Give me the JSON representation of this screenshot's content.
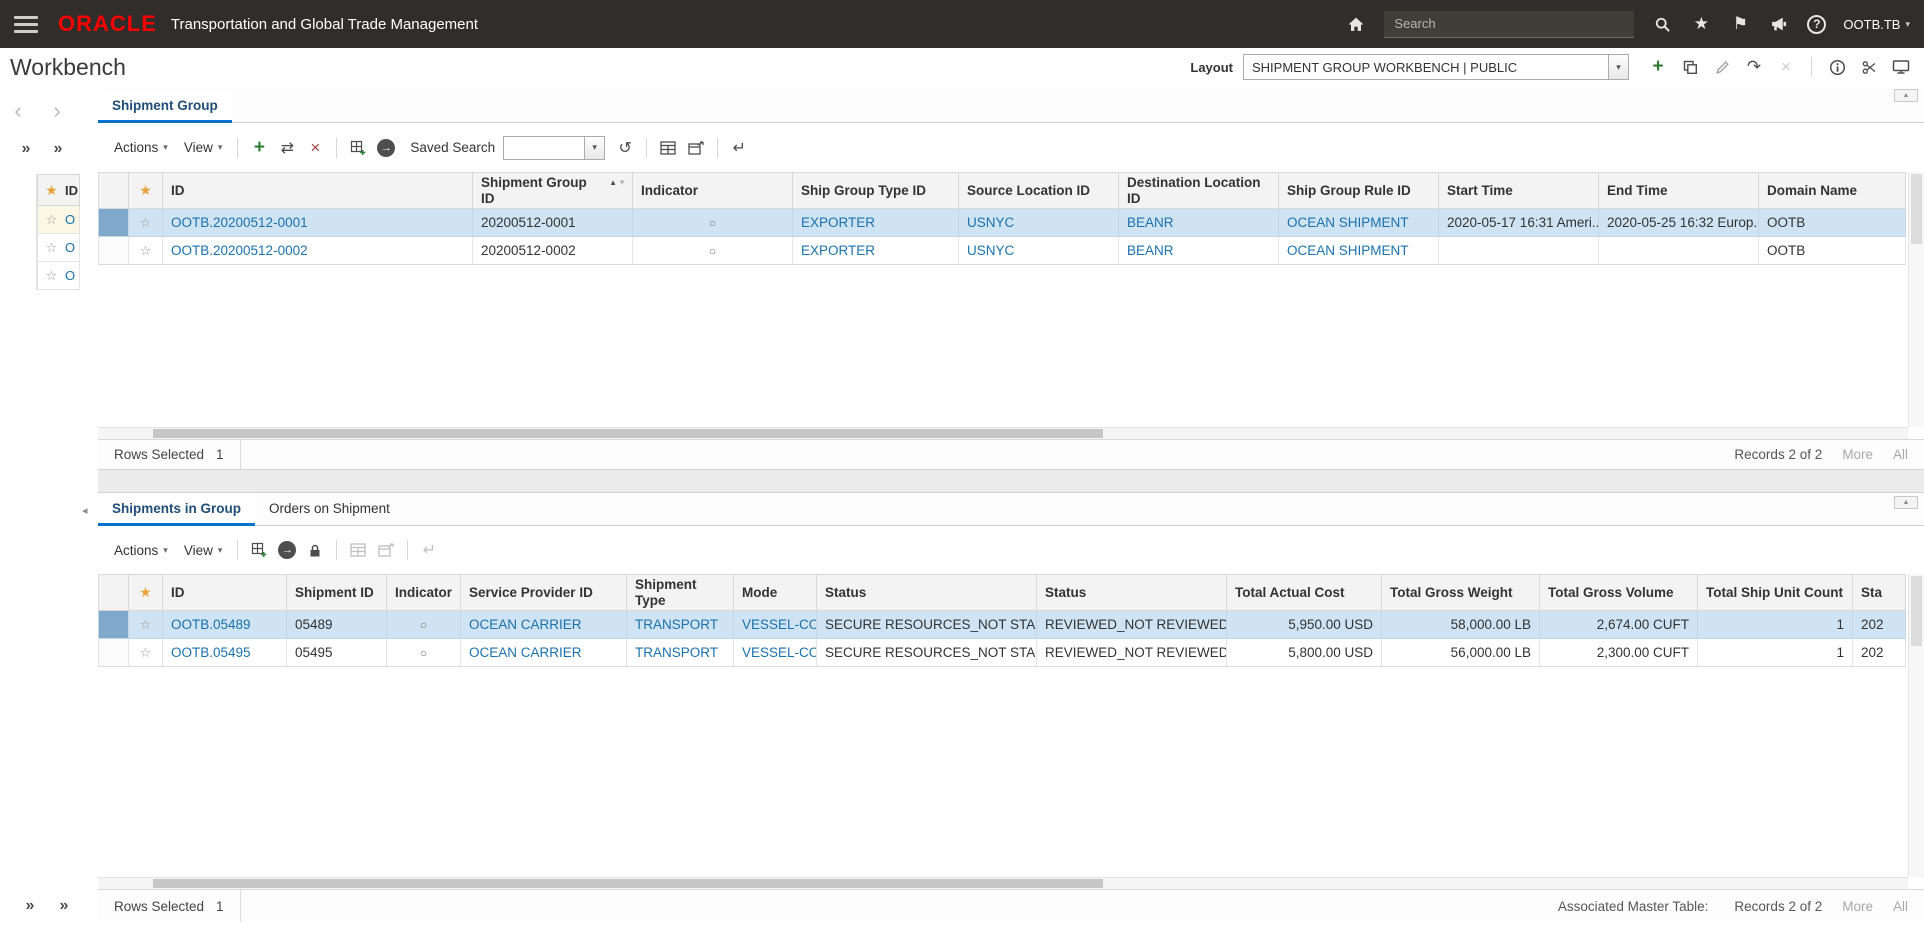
{
  "topbar": {
    "logo": "ORACLE",
    "app_title": "Transportation and Global Trade Management",
    "search_placeholder": "Search",
    "user_label": "OOTB.TB"
  },
  "header": {
    "title": "Workbench",
    "layout_label": "Layout",
    "layout_value": "SHIPMENT GROUP WORKBENCH | PUBLIC"
  },
  "icons": {
    "star_filled": "★",
    "star_outline": "☆",
    "flag": "⚑",
    "help": "?",
    "caret_down": "▾",
    "chevron_left": "‹",
    "chevron_right": "›",
    "expand_right": "»",
    "collapse_up": "▲",
    "sort_asc": "▲",
    "sort_desc": "▼",
    "indicator_circle": "○",
    "plus": "+",
    "compare": "⇄",
    "delete": "×",
    "refresh": "↺",
    "redo": "↷",
    "enter": "↵",
    "go_arrow": "→",
    "info": "i",
    "tab_scroll_left": "◂"
  },
  "left_panel": {
    "header_id": "ID",
    "rows": [
      "O",
      "O",
      "O"
    ]
  },
  "upper_panel": {
    "tab_label": "Shipment Group",
    "toolbar": {
      "actions_label": "Actions",
      "view_label": "View",
      "saved_search_label": "Saved Search"
    },
    "table": {
      "columns": [
        "ID",
        "Shipment Group ID",
        "Indicator",
        "Ship Group Type ID",
        "Source Location ID",
        "Destination Location ID",
        "Ship Group Rule ID",
        "Start Time",
        "End Time",
        "Domain Name"
      ],
      "sort_column_index": 1,
      "rows": [
        {
          "selected": true,
          "id": "OOTB.20200512-0001",
          "shipment_group_id": "20200512-0001",
          "ship_group_type_id": "EXPORTER",
          "source_location_id": "USNYC",
          "destination_location_id": "BEANR",
          "ship_group_rule_id": "OCEAN SHIPMENT",
          "start_time": "2020-05-17 16:31 Ameri...",
          "end_time": "2020-05-25 16:32 Europ...",
          "domain_name": "OOTB"
        },
        {
          "selected": false,
          "id": "OOTB.20200512-0002",
          "shipment_group_id": "20200512-0002",
          "ship_group_type_id": "EXPORTER",
          "source_location_id": "USNYC",
          "destination_location_id": "BEANR",
          "ship_group_rule_id": "OCEAN SHIPMENT",
          "start_time": "",
          "end_time": "",
          "domain_name": "OOTB"
        }
      ]
    },
    "footer": {
      "rows_selected_label": "Rows Selected",
      "rows_selected_count": "1",
      "records_label": "Records 2 of 2",
      "more_label": "More",
      "all_label": "All"
    }
  },
  "lower_panel": {
    "tabs": [
      {
        "label": "Shipments in Group",
        "active": true
      },
      {
        "label": "Orders on Shipment",
        "active": false
      }
    ],
    "toolbar": {
      "actions_label": "Actions",
      "view_label": "View"
    },
    "table": {
      "columns": [
        "ID",
        "Shipment ID",
        "Indicator",
        "Service Provider ID",
        "Shipment Type",
        "Mode",
        "Status",
        "Status",
        "Total Actual Cost",
        "Total Gross Weight",
        "Total Gross Volume",
        "Total Ship Unit Count",
        "Sta"
      ],
      "rows": [
        {
          "selected": true,
          "id": "OOTB.05489",
          "shipment_id": "05489",
          "service_provider_id": "OCEAN CARRIER",
          "shipment_type": "TRANSPORT",
          "mode": "VESSEL-CO",
          "status1": "SECURE RESOURCES_NOT STARTED",
          "status2": "REVIEWED_NOT REVIEWED",
          "total_actual_cost": "5,950.00 USD",
          "total_gross_weight": "58,000.00 LB",
          "total_gross_volume": "2,674.00 CUFT",
          "total_ship_unit_count": "1",
          "sta": "202"
        },
        {
          "selected": false,
          "id": "OOTB.05495",
          "shipment_id": "05495",
          "service_provider_id": "OCEAN CARRIER",
          "shipment_type": "TRANSPORT",
          "mode": "VESSEL-CO",
          "status1": "SECURE RESOURCES_NOT STARTED",
          "status2": "REVIEWED_NOT REVIEWED",
          "total_actual_cost": "5,800.00 USD",
          "total_gross_weight": "56,000.00 LB",
          "total_gross_volume": "2,300.00 CUFT",
          "total_ship_unit_count": "1",
          "sta": "202"
        }
      ]
    },
    "footer": {
      "rows_selected_label": "Rows Selected",
      "rows_selected_count": "1",
      "associated_label": "Associated Master Table:",
      "records_label": "Records 2 of 2",
      "more_label": "More",
      "all_label": "All"
    }
  },
  "colors": {
    "topbar_bg": "#312d2a",
    "oracle_red": "#f80000",
    "link_blue": "#1a72ad",
    "selected_row_bg": "#cfe3f2",
    "active_tab_underline": "#0572ce",
    "star_gold": "#e8a33d"
  }
}
